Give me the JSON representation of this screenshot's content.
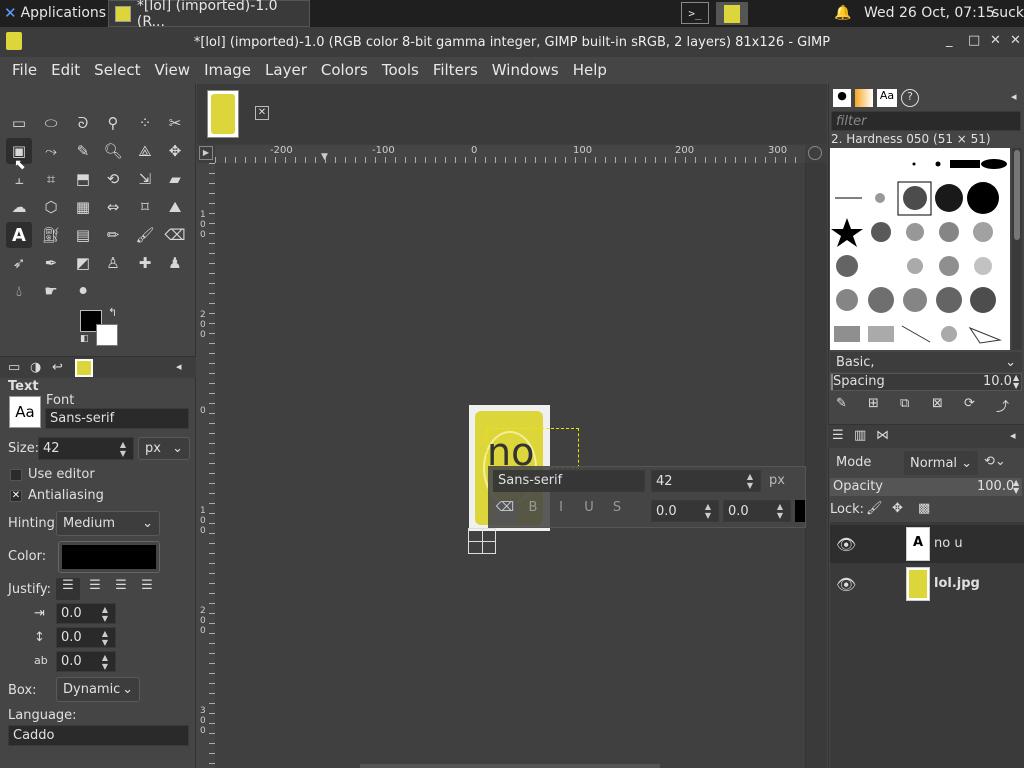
{
  "system_panel": {
    "applications_label": "Applications",
    "task_label": "*[lol] (imported)-1.0 (R...",
    "terminal_label": ">_",
    "clock": "Wed 26 Oct, 07:15",
    "user": "suck"
  },
  "window": {
    "title": "*[lol] (imported)-1.0 (RGB color 8-bit gamma integer, GIMP built-in sRGB, 2 layers) 81x126 - GIMP",
    "minimize": "_",
    "maximize": "□",
    "close": "✕"
  },
  "menu": [
    "File",
    "Edit",
    "Select",
    "View",
    "Image",
    "Layer",
    "Colors",
    "Tools",
    "Filters",
    "Windows",
    "Help"
  ],
  "tool_options": {
    "title": "Text",
    "font_label": "Font",
    "font_value": "Sans-serif",
    "font_preview": "Aa",
    "size_label": "Size:",
    "size_value": "42",
    "size_unit": "px",
    "use_editor": "Use editor",
    "antialiasing": "Antialiasing",
    "hinting_label": "Hinting:",
    "hinting_value": "Medium",
    "color_label": "Color:",
    "justify_label": "Justify:",
    "indent_value": "0.0",
    "line_spacing_value": "0.0",
    "letter_spacing_value": "0.0",
    "box_label": "Box:",
    "box_value": "Dynamic",
    "language_label": "Language:",
    "language_value": "Caddo"
  },
  "canvas": {
    "ruler_labels": [
      "-200",
      "-100",
      "0",
      "100",
      "200",
      "300"
    ],
    "vruler_labels": [
      "1\n0\n0",
      "2\n0\n0",
      "0",
      "1\n0\n0",
      "2\n0\n0",
      "3\n0\n0"
    ],
    "text_content": "no",
    "on_canvas_font": "Sans-serif",
    "on_canvas_size": "42",
    "on_canvas_unit": "px",
    "on_canvas_baseline": "0.0",
    "on_canvas_kerning": "0.0"
  },
  "brushes": {
    "filter_placeholder": "filter",
    "brush_name": "2. Hardness 050 (51 × 51)",
    "tag": "Basic,",
    "spacing_label": "Spacing",
    "spacing_value": "10.0"
  },
  "layers": {
    "mode_label": "Mode",
    "mode_value": "Normal",
    "opacity_label": "Opacity",
    "opacity_value": "100.0",
    "lock_label": "Lock:",
    "items": [
      {
        "name": "no u",
        "kind": "text"
      },
      {
        "name": "lol.jpg",
        "kind": "image"
      }
    ]
  },
  "colors": {
    "accent_yellow": "#ddd63a",
    "foreground": "#000000",
    "background": "#ffffff"
  }
}
